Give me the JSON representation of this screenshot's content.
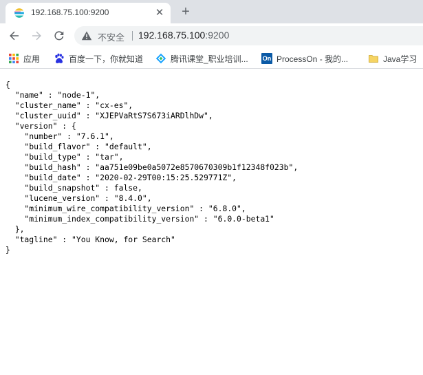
{
  "tab": {
    "title": "192.168.75.100:9200",
    "favicon": "elastic-icon",
    "close_glyph": "✕",
    "new_tab_glyph": "+"
  },
  "toolbar": {
    "back_icon": "back-arrow-icon",
    "forward_icon": "forward-arrow-icon",
    "reload_icon": "reload-icon",
    "security_label": "不安全",
    "url_host": "192.168.75.100",
    "url_port": ":9200"
  },
  "bookmarks": [
    {
      "label": "应用",
      "icon": "apps-grid-icon"
    },
    {
      "label": "百度一下，你就知道",
      "icon": "baidu-paw-icon"
    },
    {
      "label": "腾讯课堂_职业培训...",
      "icon": "tencent-classroom-icon"
    },
    {
      "label": "ProcessOn - 我的...",
      "icon": "processon-icon",
      "icon_text": "On"
    },
    {
      "label": "Java学习",
      "icon": "folder-icon"
    }
  ],
  "json_lines": [
    "{",
    "  \"name\" : \"node-1\",",
    "  \"cluster_name\" : \"cx-es\",",
    "  \"cluster_uuid\" : \"XJEPVaRtS7S673iARDlhDw\",",
    "  \"version\" : {",
    "    \"number\" : \"7.6.1\",",
    "    \"build_flavor\" : \"default\",",
    "    \"build_type\" : \"tar\",",
    "    \"build_hash\" : \"aa751e09be0a5072e8570670309b1f12348f023b\",",
    "    \"build_date\" : \"2020-02-29T00:15:25.529771Z\",",
    "    \"build_snapshot\" : false,",
    "    \"lucene_version\" : \"8.4.0\",",
    "    \"minimum_wire_compatibility_version\" : \"6.8.0\",",
    "    \"minimum_index_compatibility_version\" : \"6.0.0-beta1\"",
    "  },",
    "  \"tagline\" : \"You Know, for Search\"",
    "}"
  ]
}
